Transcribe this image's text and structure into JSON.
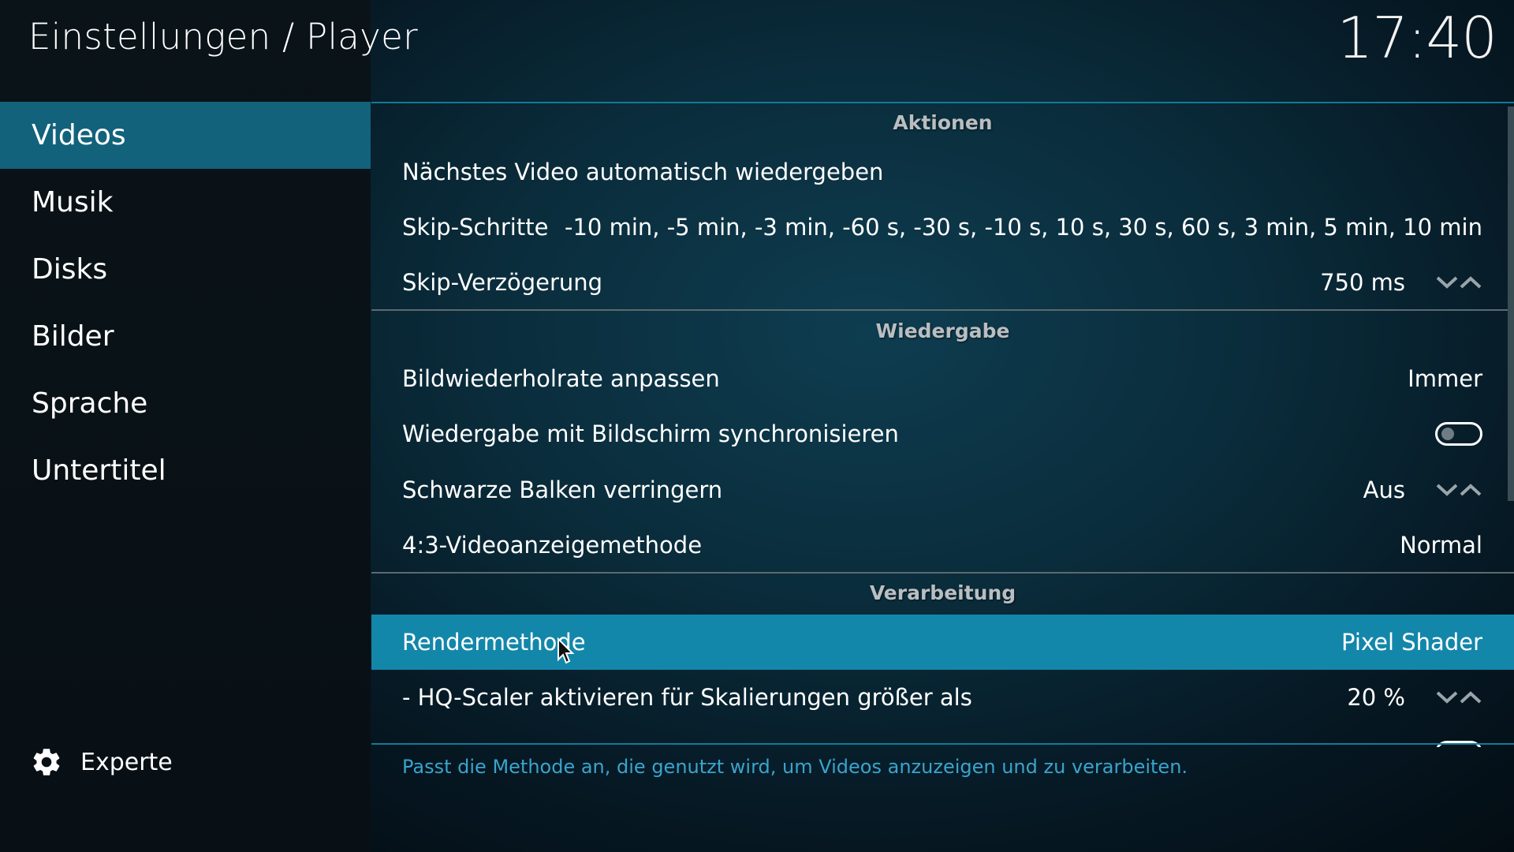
{
  "header": {
    "title": "Einstellungen / Player",
    "clock": "17:40"
  },
  "sidebar": {
    "items": [
      {
        "label": "Videos",
        "active": true
      },
      {
        "label": "Musik",
        "active": false
      },
      {
        "label": "Disks",
        "active": false
      },
      {
        "label": "Bilder",
        "active": false
      },
      {
        "label": "Sprache",
        "active": false
      },
      {
        "label": "Untertitel",
        "active": false
      }
    ],
    "level_button": {
      "label": "Experte",
      "icon": "gear-icon"
    }
  },
  "sections": {
    "aktionen": {
      "title": "Aktionen",
      "rows": [
        {
          "label": "Nächstes Video automatisch wiedergeben",
          "value": ""
        },
        {
          "label": "Skip-Schritte",
          "value": "-10 min, -5 min, -3 min, -60 s, -30 s, -10 s, 10 s, 30 s, 60 s, 3 min, 5 min, 10 min"
        },
        {
          "label": "Skip-Verzögerung",
          "value": "750 ms"
        }
      ]
    },
    "wiedergabe": {
      "title": "Wiedergabe",
      "rows": [
        {
          "label": "Bildwiederholrate anpassen",
          "value": "Immer"
        },
        {
          "label": "Wiedergabe mit Bildschirm synchronisieren",
          "toggle": false
        },
        {
          "label": "Schwarze Balken verringern",
          "value": "Aus"
        },
        {
          "label": "4:3-Videoanzeigemethode",
          "value": "Normal"
        }
      ]
    },
    "verarbeitung": {
      "title": "Verarbeitung",
      "rows": [
        {
          "label": "Rendermethode",
          "value": "Pixel Shader",
          "focused": true
        },
        {
          "label": "- HQ-Scaler aktivieren für Skalierungen größer als",
          "value": "20 %"
        }
      ]
    }
  },
  "description": "Passt die Methode an, die genutzt wird, um Videos anzuzeigen und zu verarbeiten.",
  "colors": {
    "accent": "#12627c",
    "focus": "#1387aa",
    "description": "#3aa4cc",
    "divider": "#137a97"
  }
}
